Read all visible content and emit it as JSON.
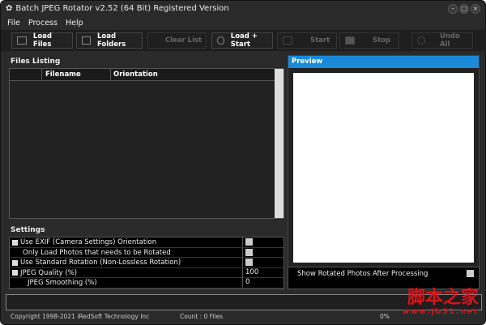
{
  "window": {
    "title": "Batch JPEG Rotator v2.52 (64 Bit) Registered Version"
  },
  "menu": [
    "File",
    "Process",
    "Help"
  ],
  "toolbar": [
    {
      "label": "Load Files",
      "enabled": true
    },
    {
      "label": "Load Folders",
      "enabled": true
    },
    {
      "label": "Clear List",
      "enabled": false
    },
    {
      "label": "Load + Start",
      "enabled": true
    },
    {
      "label": "Start",
      "enabled": false
    },
    {
      "label": "Stop",
      "enabled": false
    },
    {
      "label": "Undo All",
      "enabled": false
    }
  ],
  "files": {
    "title": "Files Listing",
    "columns": [
      "",
      "Filename",
      "Orientation"
    ]
  },
  "preview": {
    "title": "Preview",
    "show_rotated_label": "Show Rotated Photos After Processing"
  },
  "settings": {
    "title": "Settings",
    "rows": [
      {
        "label": "Use EXIF (Camera Settings) Orientation",
        "value": ""
      },
      {
        "label": "Only Load Photos that needs to be Rotated",
        "value": ""
      },
      {
        "label": "Use Standard Rotation (Non-Lossless Rotation)",
        "value": ""
      },
      {
        "label": "JPEG Quality (%)",
        "value": "100"
      },
      {
        "label": "JPEG Smoothing (%)",
        "value": "0"
      }
    ]
  },
  "status": {
    "copyright": "Copyright 1998-2021 iRedSoft Technology Inc",
    "count": "Count : 0 Files",
    "percent": "0%"
  },
  "watermark": {
    "text": "脚本之家",
    "url": "www.jb51.net"
  }
}
